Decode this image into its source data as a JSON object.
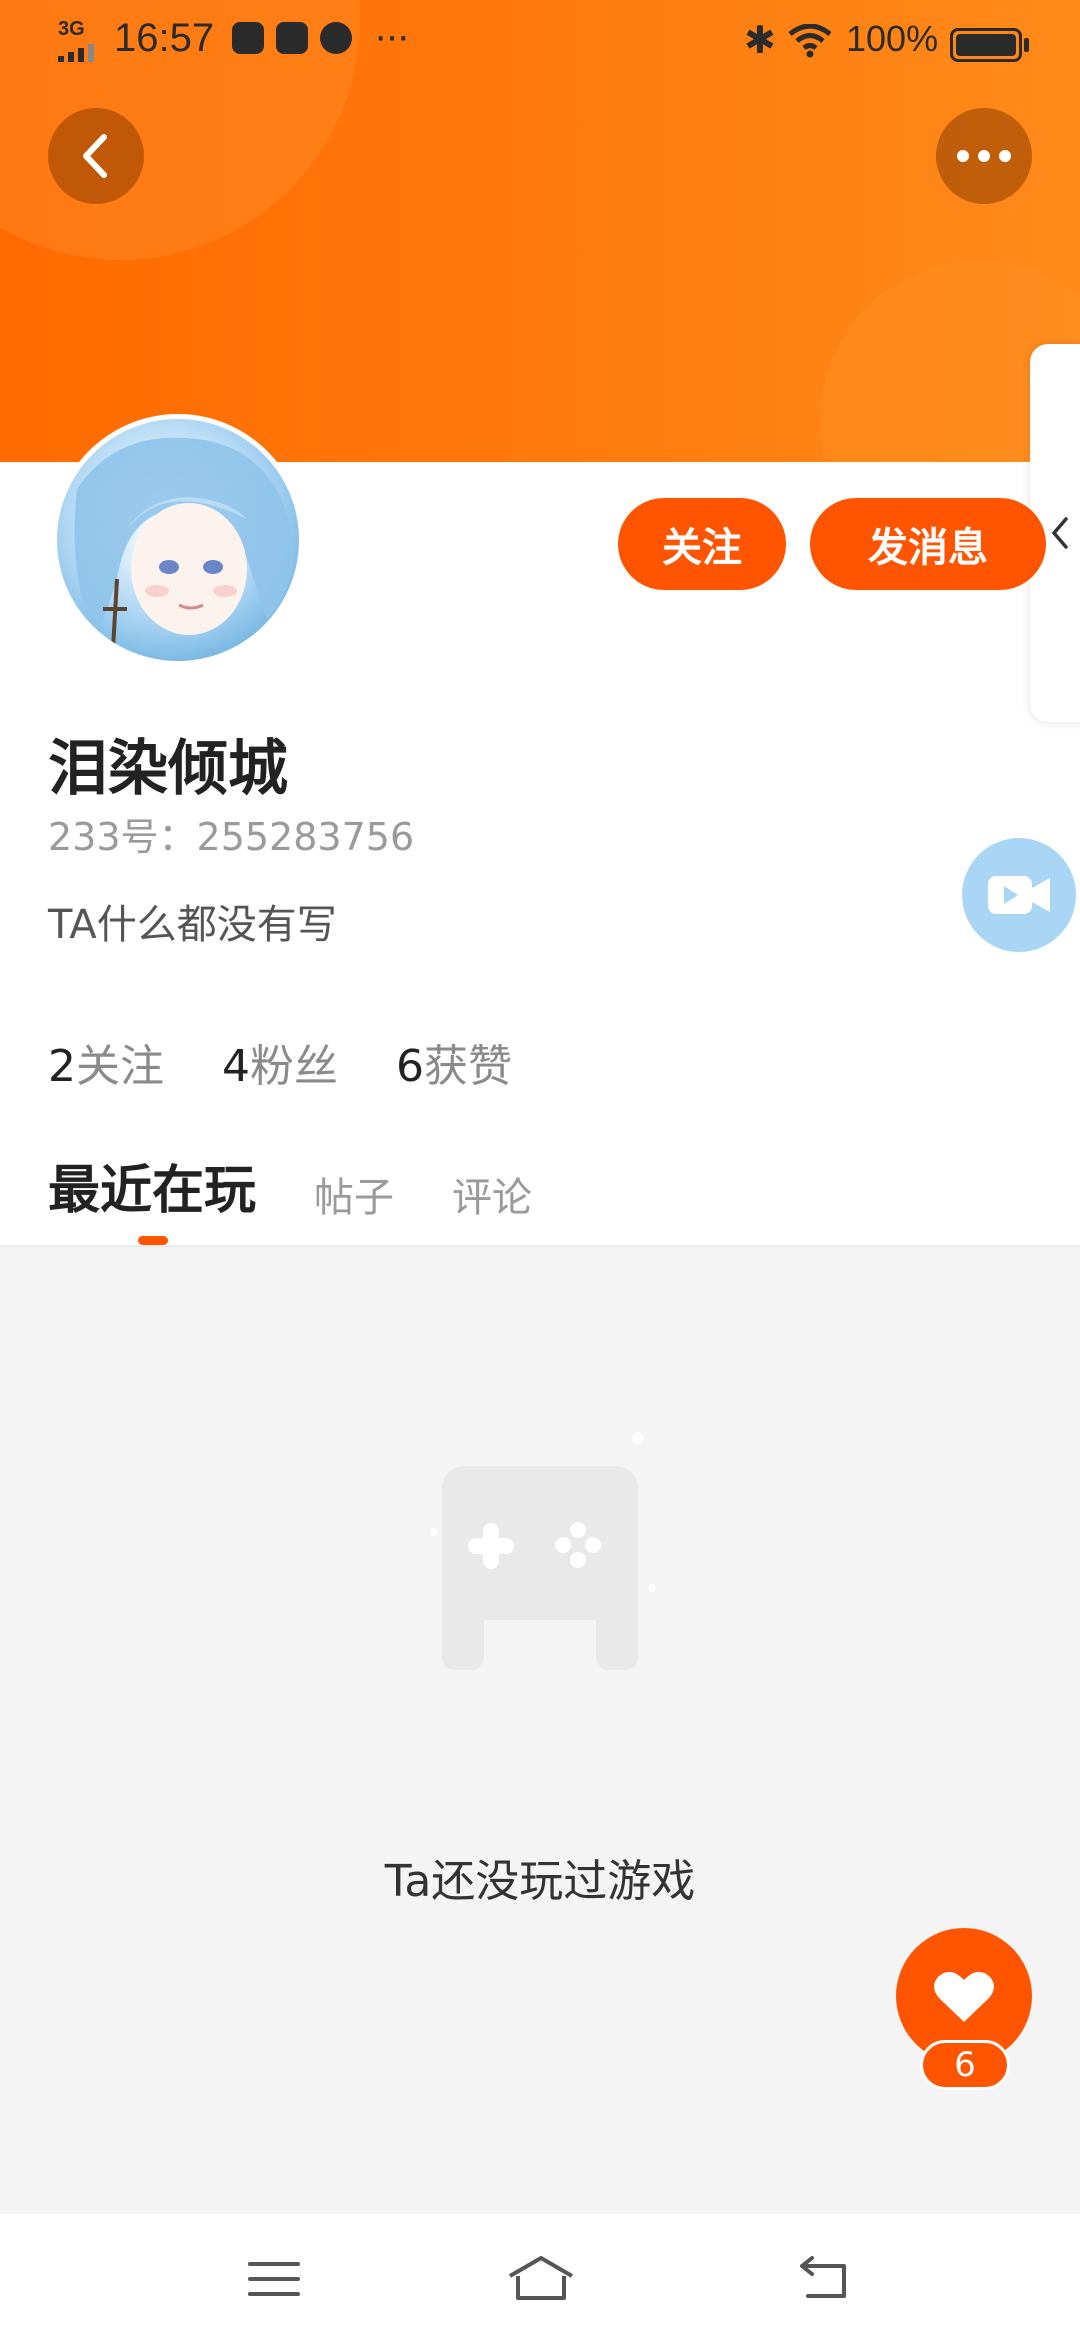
{
  "status_bar": {
    "network": "3G",
    "time": "16:57",
    "more": "···",
    "battery": "100%"
  },
  "header": {
    "back_icon": "chevron-left-icon",
    "more_icon": "more-dots-icon",
    "side_tab_icon": "chevron-left-icon"
  },
  "profile": {
    "name": "泪染倾城",
    "id_line": "233号：255283756",
    "bio": "TA什么都没有写",
    "follow_label": "关注",
    "message_label": "发消息"
  },
  "stats": [
    {
      "num": "2",
      "label": "关注"
    },
    {
      "num": "4",
      "label": "粉丝"
    },
    {
      "num": "6",
      "label": "获赞"
    }
  ],
  "tabs": [
    {
      "label": "最近在玩",
      "active": true
    },
    {
      "label": "帖子",
      "active": false
    },
    {
      "label": "评论",
      "active": false
    }
  ],
  "empty_state": {
    "icon": "gamepad-icon",
    "text": "Ta还没玩过游戏"
  },
  "like": {
    "icon": "heart-icon",
    "count": "6"
  },
  "nav": {
    "menu_icon": "menu-icon",
    "home_icon": "home-icon",
    "back_icon": "back-icon"
  },
  "colors": {
    "accent": "#ff5500",
    "header_gradient_start": "#ff6a00",
    "header_gradient_end": "#ff8a1a",
    "video_btn": "#a9d6f5"
  }
}
